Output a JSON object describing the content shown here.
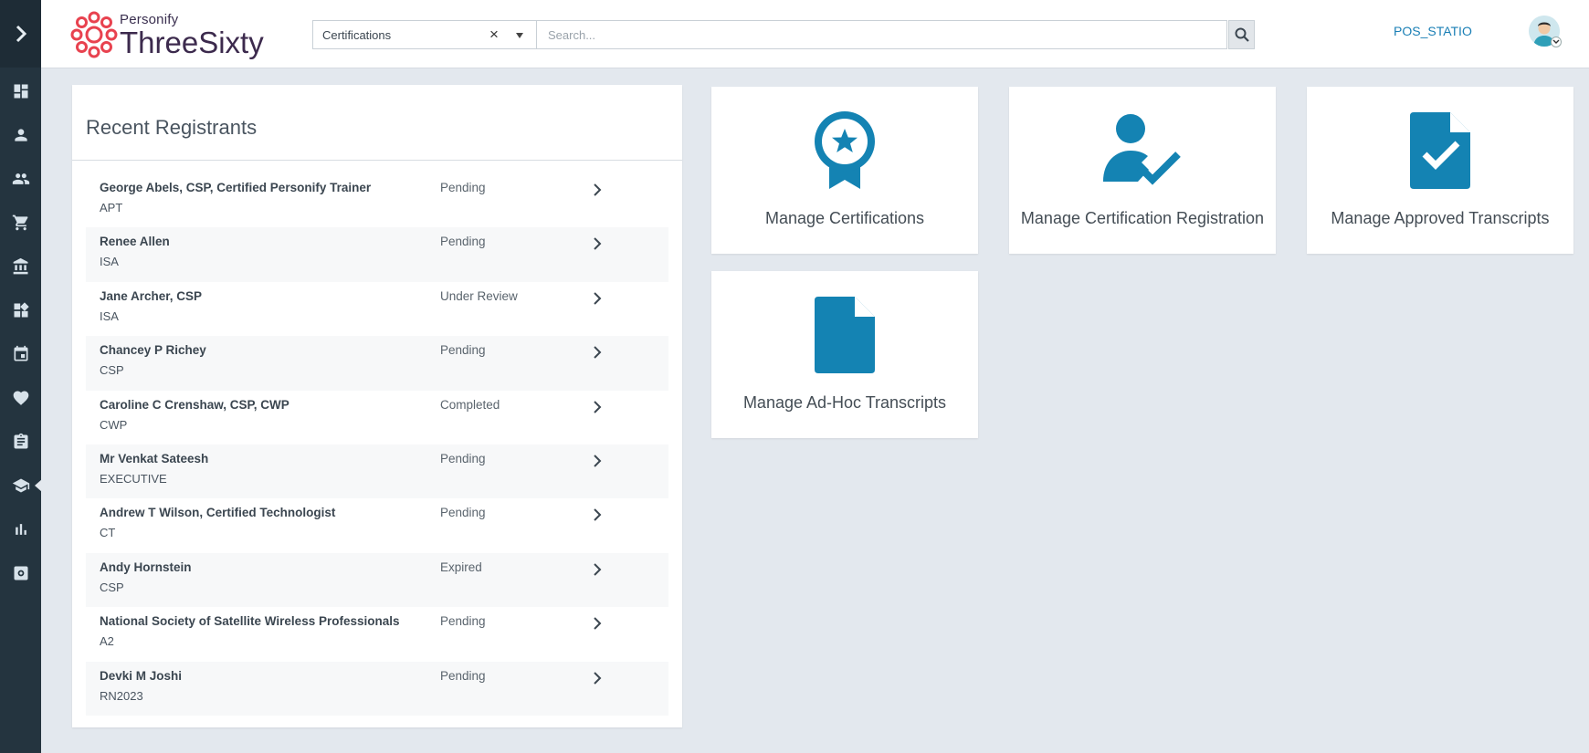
{
  "header": {
    "logo_small": "Personify",
    "logo_big": "ThreeSixty",
    "scope_value": "Certifications",
    "search_placeholder": "Search...",
    "user_name": "POS_STATIO"
  },
  "rail": {
    "items": [
      {
        "icon": "dashboard-icon"
      },
      {
        "icon": "person-icon"
      },
      {
        "icon": "people-icon"
      },
      {
        "icon": "cart-icon"
      },
      {
        "icon": "bank-icon"
      },
      {
        "icon": "widgets-icon"
      },
      {
        "icon": "calendar-icon"
      },
      {
        "icon": "heart-icon"
      },
      {
        "icon": "clipboard-icon"
      },
      {
        "icon": "graduation-cap-icon",
        "active": true
      },
      {
        "icon": "bar-chart-icon"
      },
      {
        "icon": "settings-icon"
      }
    ]
  },
  "recent": {
    "title": "Recent Registrants",
    "rows": [
      {
        "name": "George Abels, CSP, Certified Personify Trainer",
        "code": "APT",
        "status": "Pending"
      },
      {
        "name": "Renee Allen",
        "code": "ISA",
        "status": "Pending"
      },
      {
        "name": "Jane Archer, CSP",
        "code": "ISA",
        "status": "Under Review"
      },
      {
        "name": "Chancey P Richey",
        "code": "CSP",
        "status": "Pending"
      },
      {
        "name": "Caroline C Crenshaw, CSP, CWP",
        "code": "CWP",
        "status": "Completed"
      },
      {
        "name": "Mr Venkat Sateesh",
        "code": "EXECUTIVE",
        "status": "Pending"
      },
      {
        "name": "Andrew T Wilson, Certified Technologist",
        "code": "CT",
        "status": "Pending"
      },
      {
        "name": "Andy Hornstein",
        "code": "CSP",
        "status": "Expired"
      },
      {
        "name": "National Society of Satellite Wireless Professionals",
        "code": "A2",
        "status": "Pending"
      },
      {
        "name": "Devki M Joshi",
        "code": "RN2023",
        "status": "Pending"
      }
    ]
  },
  "tiles": [
    {
      "label": "Manage Certifications",
      "icon": "award-icon"
    },
    {
      "label": "Manage Certification Registration",
      "icon": "person-check-icon"
    },
    {
      "label": "Manage Approved Transcripts",
      "icon": "document-check-icon"
    },
    {
      "label": "Manage Ad-Hoc Transcripts",
      "icon": "document-icon"
    }
  ],
  "colors": {
    "accent": "#1a7fb5",
    "rail": "#24343f",
    "logo_red": "#e8424f"
  }
}
